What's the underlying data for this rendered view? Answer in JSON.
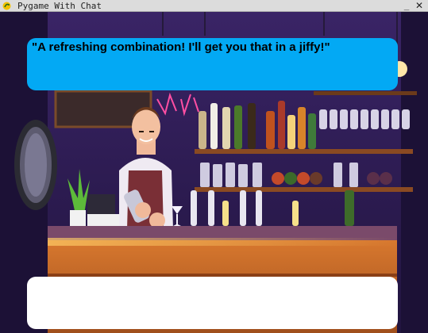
{
  "window": {
    "title": "Pygame With Chat",
    "minimize_glyph": "_",
    "close_glyph": "✕"
  },
  "icons": {
    "app": "python-snake-icon",
    "minimize": "minimize-icon",
    "close": "close-icon"
  },
  "dialogue": {
    "text": "\"A refreshing combination! I'll get you that in a jiffy!\"",
    "bubble_color": "#03a9f4"
  },
  "chat": {
    "value": ""
  },
  "scene": {
    "description_tag": "bartender-bar-scene"
  }
}
